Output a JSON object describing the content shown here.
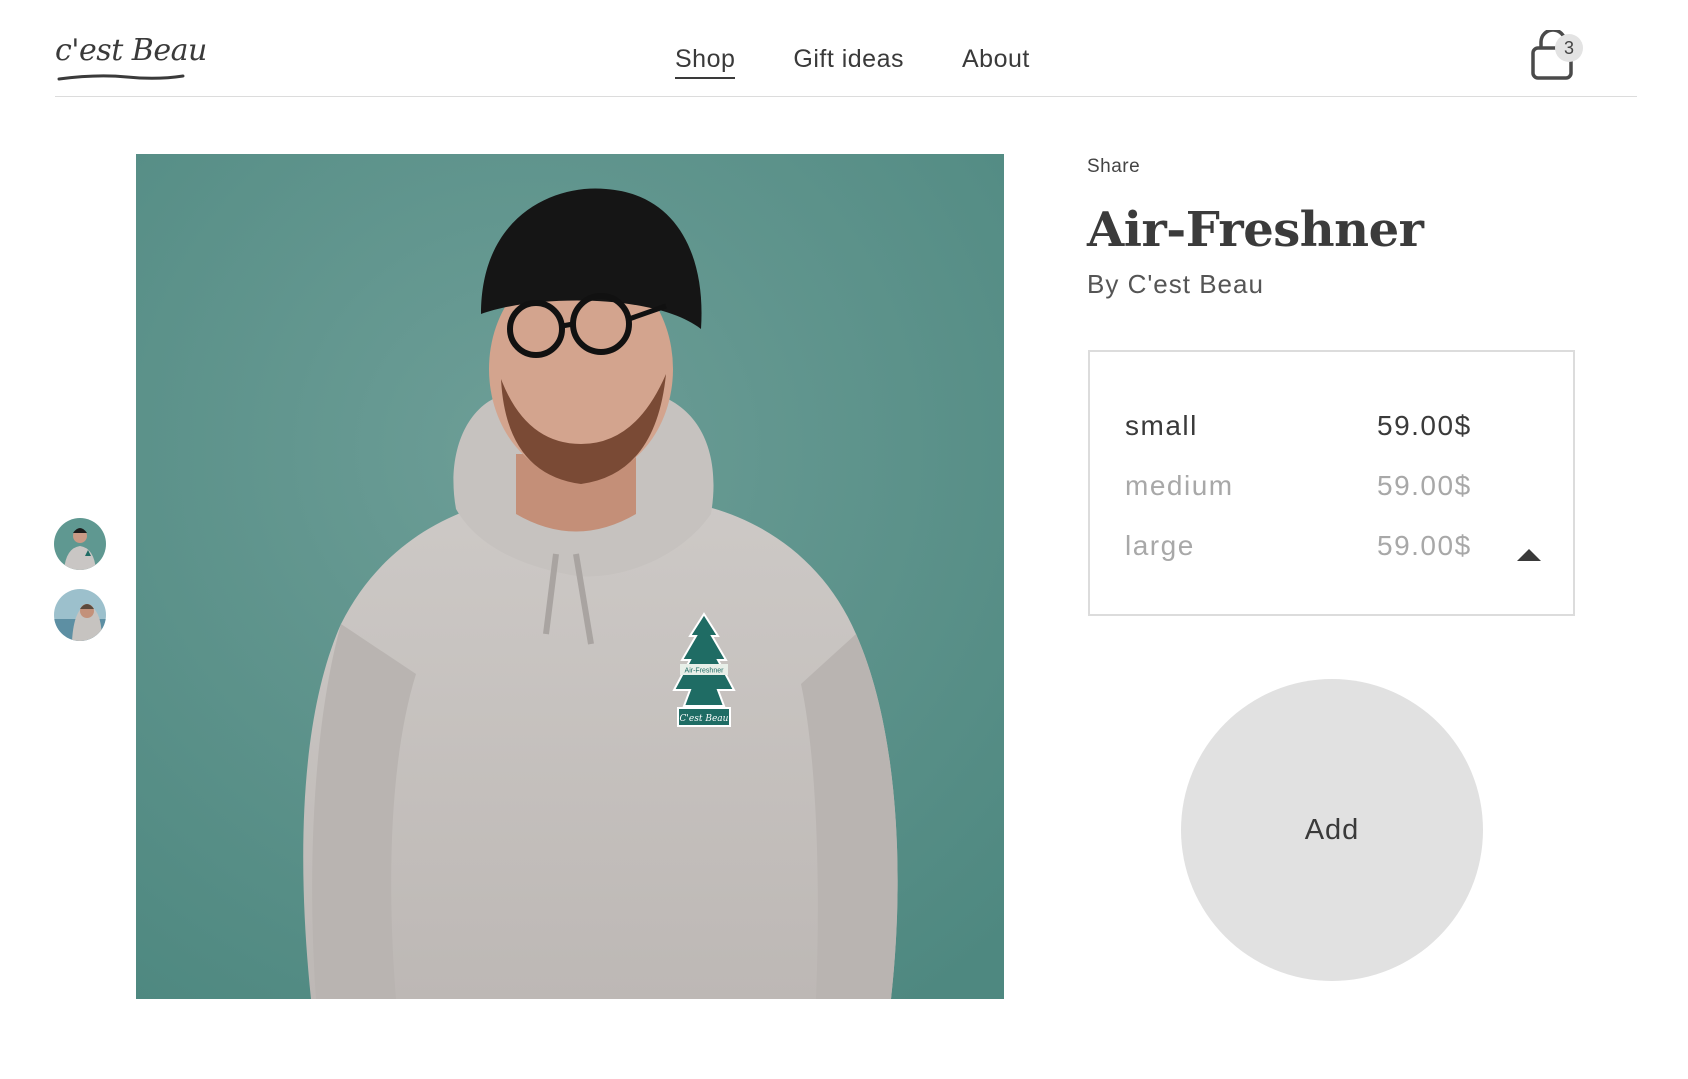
{
  "brand": {
    "logo_text": "c'est Beau"
  },
  "nav": {
    "items": [
      {
        "label": "Shop",
        "active": true
      },
      {
        "label": "Gift ideas",
        "active": false
      },
      {
        "label": "About",
        "active": false
      }
    ]
  },
  "cart": {
    "count": "3",
    "icon": "shopping-bag-icon"
  },
  "gallery": {
    "thumbnails": [
      {
        "icon": "hoodie-model-thumbnail"
      },
      {
        "icon": "hoodie-model-alt-thumbnail"
      }
    ]
  },
  "product": {
    "share_label": "Share",
    "name": "Air-Freshner",
    "byline": "By C'est Beau",
    "patch_label": "Air-Freshner",
    "patch_brand": "C'est Beau",
    "variants": [
      {
        "size": "small",
        "price": "59.00$",
        "selected": true
      },
      {
        "size": "medium",
        "price": "59.00$",
        "selected": false
      },
      {
        "size": "large",
        "price": "59.00$",
        "selected": false
      }
    ],
    "add_label": "Add"
  },
  "colors": {
    "photo_background": "#5f9891",
    "text": "#3b3b3b",
    "muted_text": "#a8a8a8",
    "add_button": "#e1e1e1",
    "divider": "#dcdcdc"
  }
}
